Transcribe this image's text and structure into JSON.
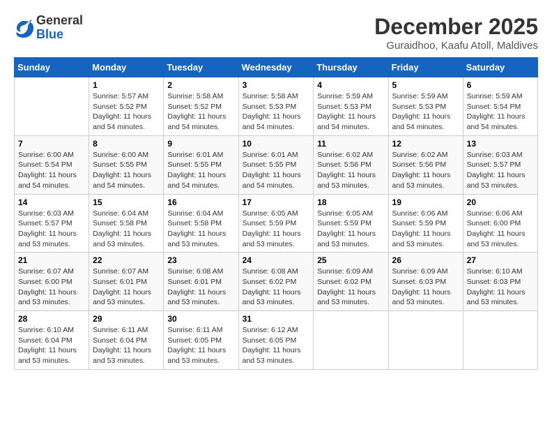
{
  "logo": {
    "general": "General",
    "blue": "Blue"
  },
  "title": "December 2025",
  "location": "Guraidhoo, Kaafu Atoll, Maldives",
  "days_of_week": [
    "Sunday",
    "Monday",
    "Tuesday",
    "Wednesday",
    "Thursday",
    "Friday",
    "Saturday"
  ],
  "weeks": [
    [
      {
        "day": "",
        "sunrise": "",
        "sunset": "",
        "daylight": ""
      },
      {
        "day": "1",
        "sunrise": "Sunrise: 5:57 AM",
        "sunset": "Sunset: 5:52 PM",
        "daylight": "Daylight: 11 hours and 54 minutes."
      },
      {
        "day": "2",
        "sunrise": "Sunrise: 5:58 AM",
        "sunset": "Sunset: 5:52 PM",
        "daylight": "Daylight: 11 hours and 54 minutes."
      },
      {
        "day": "3",
        "sunrise": "Sunrise: 5:58 AM",
        "sunset": "Sunset: 5:53 PM",
        "daylight": "Daylight: 11 hours and 54 minutes."
      },
      {
        "day": "4",
        "sunrise": "Sunrise: 5:59 AM",
        "sunset": "Sunset: 5:53 PM",
        "daylight": "Daylight: 11 hours and 54 minutes."
      },
      {
        "day": "5",
        "sunrise": "Sunrise: 5:59 AM",
        "sunset": "Sunset: 5:53 PM",
        "daylight": "Daylight: 11 hours and 54 minutes."
      },
      {
        "day": "6",
        "sunrise": "Sunrise: 5:59 AM",
        "sunset": "Sunset: 5:54 PM",
        "daylight": "Daylight: 11 hours and 54 minutes."
      }
    ],
    [
      {
        "day": "7",
        "sunrise": "Sunrise: 6:00 AM",
        "sunset": "Sunset: 5:54 PM",
        "daylight": "Daylight: 11 hours and 54 minutes."
      },
      {
        "day": "8",
        "sunrise": "Sunrise: 6:00 AM",
        "sunset": "Sunset: 5:55 PM",
        "daylight": "Daylight: 11 hours and 54 minutes."
      },
      {
        "day": "9",
        "sunrise": "Sunrise: 6:01 AM",
        "sunset": "Sunset: 5:55 PM",
        "daylight": "Daylight: 11 hours and 54 minutes."
      },
      {
        "day": "10",
        "sunrise": "Sunrise: 6:01 AM",
        "sunset": "Sunset: 5:55 PM",
        "daylight": "Daylight: 11 hours and 54 minutes."
      },
      {
        "day": "11",
        "sunrise": "Sunrise: 6:02 AM",
        "sunset": "Sunset: 5:56 PM",
        "daylight": "Daylight: 11 hours and 53 minutes."
      },
      {
        "day": "12",
        "sunrise": "Sunrise: 6:02 AM",
        "sunset": "Sunset: 5:56 PM",
        "daylight": "Daylight: 11 hours and 53 minutes."
      },
      {
        "day": "13",
        "sunrise": "Sunrise: 6:03 AM",
        "sunset": "Sunset: 5:57 PM",
        "daylight": "Daylight: 11 hours and 53 minutes."
      }
    ],
    [
      {
        "day": "14",
        "sunrise": "Sunrise: 6:03 AM",
        "sunset": "Sunset: 5:57 PM",
        "daylight": "Daylight: 11 hours and 53 minutes."
      },
      {
        "day": "15",
        "sunrise": "Sunrise: 6:04 AM",
        "sunset": "Sunset: 5:58 PM",
        "daylight": "Daylight: 11 hours and 53 minutes."
      },
      {
        "day": "16",
        "sunrise": "Sunrise: 6:04 AM",
        "sunset": "Sunset: 5:58 PM",
        "daylight": "Daylight: 11 hours and 53 minutes."
      },
      {
        "day": "17",
        "sunrise": "Sunrise: 6:05 AM",
        "sunset": "Sunset: 5:59 PM",
        "daylight": "Daylight: 11 hours and 53 minutes."
      },
      {
        "day": "18",
        "sunrise": "Sunrise: 6:05 AM",
        "sunset": "Sunset: 5:59 PM",
        "daylight": "Daylight: 11 hours and 53 minutes."
      },
      {
        "day": "19",
        "sunrise": "Sunrise: 6:06 AM",
        "sunset": "Sunset: 5:59 PM",
        "daylight": "Daylight: 11 hours and 53 minutes."
      },
      {
        "day": "20",
        "sunrise": "Sunrise: 6:06 AM",
        "sunset": "Sunset: 6:00 PM",
        "daylight": "Daylight: 11 hours and 53 minutes."
      }
    ],
    [
      {
        "day": "21",
        "sunrise": "Sunrise: 6:07 AM",
        "sunset": "Sunset: 6:00 PM",
        "daylight": "Daylight: 11 hours and 53 minutes."
      },
      {
        "day": "22",
        "sunrise": "Sunrise: 6:07 AM",
        "sunset": "Sunset: 6:01 PM",
        "daylight": "Daylight: 11 hours and 53 minutes."
      },
      {
        "day": "23",
        "sunrise": "Sunrise: 6:08 AM",
        "sunset": "Sunset: 6:01 PM",
        "daylight": "Daylight: 11 hours and 53 minutes."
      },
      {
        "day": "24",
        "sunrise": "Sunrise: 6:08 AM",
        "sunset": "Sunset: 6:02 PM",
        "daylight": "Daylight: 11 hours and 53 minutes."
      },
      {
        "day": "25",
        "sunrise": "Sunrise: 6:09 AM",
        "sunset": "Sunset: 6:02 PM",
        "daylight": "Daylight: 11 hours and 53 minutes."
      },
      {
        "day": "26",
        "sunrise": "Sunrise: 6:09 AM",
        "sunset": "Sunset: 6:03 PM",
        "daylight": "Daylight: 11 hours and 53 minutes."
      },
      {
        "day": "27",
        "sunrise": "Sunrise: 6:10 AM",
        "sunset": "Sunset: 6:03 PM",
        "daylight": "Daylight: 11 hours and 53 minutes."
      }
    ],
    [
      {
        "day": "28",
        "sunrise": "Sunrise: 6:10 AM",
        "sunset": "Sunset: 6:04 PM",
        "daylight": "Daylight: 11 hours and 53 minutes."
      },
      {
        "day": "29",
        "sunrise": "Sunrise: 6:11 AM",
        "sunset": "Sunset: 6:04 PM",
        "daylight": "Daylight: 11 hours and 53 minutes."
      },
      {
        "day": "30",
        "sunrise": "Sunrise: 6:11 AM",
        "sunset": "Sunset: 6:05 PM",
        "daylight": "Daylight: 11 hours and 53 minutes."
      },
      {
        "day": "31",
        "sunrise": "Sunrise: 6:12 AM",
        "sunset": "Sunset: 6:05 PM",
        "daylight": "Daylight: 11 hours and 53 minutes."
      },
      {
        "day": "",
        "sunrise": "",
        "sunset": "",
        "daylight": ""
      },
      {
        "day": "",
        "sunrise": "",
        "sunset": "",
        "daylight": ""
      },
      {
        "day": "",
        "sunrise": "",
        "sunset": "",
        "daylight": ""
      }
    ]
  ]
}
